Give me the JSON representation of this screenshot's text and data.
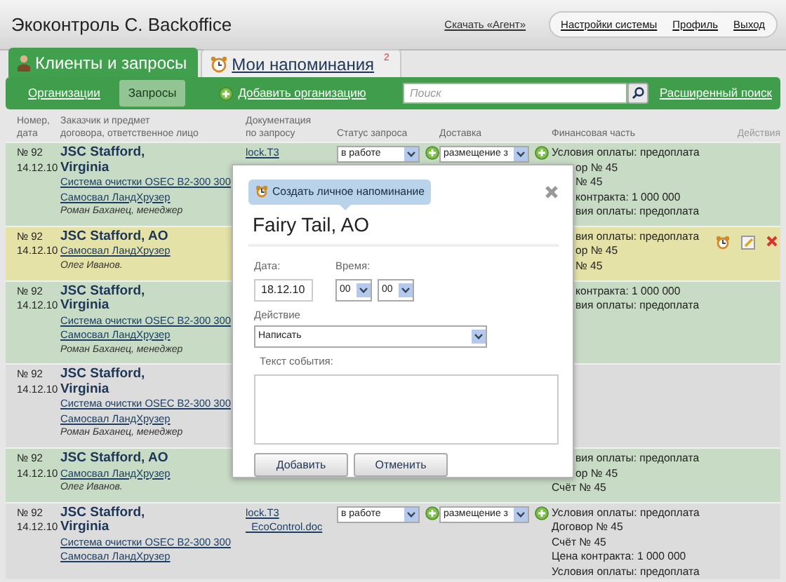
{
  "header": {
    "title": "Экоконтроль С. Backoffice",
    "download_link": "Скачать «Агент»",
    "menu": [
      "Настройки системы",
      "Профиль",
      "Выход"
    ]
  },
  "tabs": [
    {
      "label": "Клиенты и запросы",
      "selected": true
    },
    {
      "label": "Мои напоминания",
      "badge": "2",
      "selected": false
    }
  ],
  "subnav": {
    "items": [
      {
        "label": "Организации",
        "selected": false
      },
      {
        "label": "Запросы",
        "selected": true
      }
    ],
    "add_link": "Добавить организацию",
    "search": {
      "placeholder": "Поиск"
    },
    "advanced_search": "Расширенный поиск"
  },
  "table": {
    "columns": [
      {
        "lines": [
          "Номер,",
          "дата"
        ],
        "disabled": false
      },
      {
        "lines": [
          "Заказчик и предмет",
          "договора, ответственное лицо"
        ],
        "disabled": false
      },
      {
        "lines": [
          "Документация",
          "по запросу"
        ],
        "disabled": false
      },
      {
        "lines": [
          "Статус запроса"
        ],
        "disabled": false
      },
      {
        "lines": [
          "Доставка"
        ],
        "disabled": false
      },
      {
        "lines": [
          "Финансовая часть"
        ],
        "disabled": false
      },
      {
        "lines": [
          "Действия"
        ],
        "disabled": true
      }
    ],
    "rows": [
      {
        "color": "#c8dcc5",
        "number": "№ 92",
        "date": "14.12.10",
        "name_lines": [
          "JSC Stafford,",
          "Virginia"
        ],
        "links": [
          "Система очистки OSEC B2-300 300",
          "Самосвал ЛандХрузер"
        ],
        "manager": "Роман Баханец, менеджер",
        "docs": [
          "lock.T3"
        ],
        "status": "в работе",
        "delivery": "размещение з",
        "finance": [
          {
            "text": "Условия оплаты: предоплата",
            "cut": false
          },
          {
            "text": "ор № 45",
            "cut": true
          },
          {
            "text": "№ 45",
            "cut": true
          },
          {
            "text": "контракта: 1 000 000",
            "cut": true
          },
          {
            "text": "вия оплаты: предоплата",
            "cut": true
          }
        ],
        "actions": false
      },
      {
        "color": "#e5e2a8",
        "number": "№ 92",
        "date": "14.12.10",
        "name_lines": [
          "JSC Stafford, AO"
        ],
        "links": [
          "Самосвал ЛандХрузер"
        ],
        "manager": "Олег Иванов.",
        "finance": [
          {
            "text": "вия оплаты: предоплата",
            "cut": true
          },
          {
            "text": "ор № 45",
            "cut": true
          },
          {
            "text": "№ 45",
            "cut": true
          }
        ],
        "actions": true
      },
      {
        "color": "#c8dcc5",
        "number": "№ 92",
        "date": "14.12.10",
        "name_lines": [
          "JSC Stafford,",
          "Virginia"
        ],
        "links": [
          "Система очистки OSEC B2-300 300",
          "Самосвал ЛандХрузер"
        ],
        "manager": "Роман Баханец, менеджер",
        "finance": [
          {
            "text": "контракта: 1 000 000",
            "cut": true
          },
          {
            "text": "вия оплаты: предоплата",
            "cut": true
          }
        ],
        "actions": false
      },
      {
        "color": "#dcdcdc",
        "number": "№ 92",
        "date": "14.12.10",
        "name_lines": [
          "JSC Stafford,",
          "Virginia"
        ],
        "links": [
          "Система очистки OSEC B2-300 300",
          "Самосвал ЛандХрузер"
        ],
        "manager": "Роман Баханец, менеджер",
        "actions": false
      },
      {
        "color": "#c8dcc5",
        "number": "№ 92",
        "date": "14.12.10",
        "name_lines": [
          "JSC Stafford, AO"
        ],
        "links": [
          "Самосвал ЛандХрузер"
        ],
        "manager": "Олег Иванов.",
        "finance": [
          {
            "text": "вия оплаты: предоплата",
            "cut": true
          },
          {
            "text": "ор № 45",
            "cut": true
          },
          {
            "text": "Счёт № 45",
            "cut": false
          }
        ],
        "actions": false
      },
      {
        "color": "#dcdcdc",
        "number": "№ 92",
        "date": "14.12.10",
        "name_lines": [
          "JSC Stafford,",
          "Virginia"
        ],
        "links": [
          "Система очистки OSEC B2-300 300",
          "Самосвал ЛандХрузер"
        ],
        "docs": [
          "lock.T3",
          "_EcoControl.doc"
        ],
        "status": "в работе",
        "delivery": "размещение з",
        "finance": [
          {
            "text": "Условия оплаты: предоплата",
            "cut": false
          },
          {
            "text": "Договор № 45",
            "cut": false
          },
          {
            "text": "Счёт № 45",
            "cut": false
          },
          {
            "text": "Цена контракта: 1 000 000",
            "cut": false
          },
          {
            "text": "Условия оплаты: предоплата",
            "cut": false
          }
        ],
        "actions": false
      }
    ]
  },
  "dialog": {
    "tag": "Создать личное напоминание",
    "title": "Fairy Tail, AO",
    "date": {
      "label": "Дата:",
      "value": "18.12.10"
    },
    "time": {
      "label": "Время:",
      "hours": "00",
      "minutes": "00"
    },
    "action": {
      "label": "Действие",
      "value": "Написать"
    },
    "event_text": {
      "label": "Текст события:"
    },
    "buttons": [
      "Добавить",
      "Отменить"
    ]
  }
}
